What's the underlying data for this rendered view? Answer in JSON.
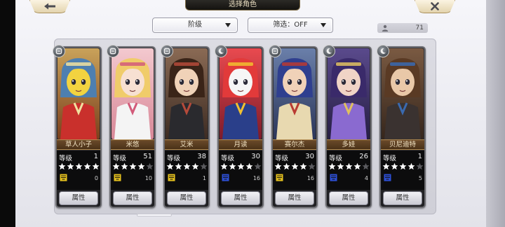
{
  "header": {
    "title": "选择角色",
    "back_icon": "back-arrow-icon",
    "close_icon": "close-x-icon"
  },
  "toolbar": {
    "sort_label": "阶级",
    "filter_label": "筛选：OFF",
    "character_count": "71",
    "count_icon": "user-icon"
  },
  "characters": [
    {
      "name": "草人小子",
      "level_label": "等级",
      "level": "1",
      "stars": 5,
      "count": "0",
      "rank_color": "#e6c21e",
      "type_icon": "plain-type-icon"
    },
    {
      "name": "米悠",
      "level_label": "等级",
      "level": "51",
      "stars": 4,
      "count": "10",
      "rank_color": "#e6c21e",
      "type_icon": "plain-type-icon"
    },
    {
      "name": "艾米",
      "level_label": "等级",
      "level": "38",
      "stars": 4,
      "count": "1",
      "rank_color": "#e6c21e",
      "type_icon": "plain-type-icon"
    },
    {
      "name": "月读",
      "level_label": "等级",
      "level": "30",
      "stars": 4,
      "count": "16",
      "rank_color": "#2d4fd6",
      "type_icon": "moon-type-icon"
    },
    {
      "name": "赛尔杰",
      "level_label": "等级",
      "level": "30",
      "stars": 4,
      "count": "16",
      "rank_color": "#e6c21e",
      "type_icon": "plain-type-icon"
    },
    {
      "name": "多娃",
      "level_label": "等级",
      "level": "26",
      "stars": 4,
      "count": "4",
      "rank_color": "#2d4fd6",
      "type_icon": "moon-type-icon"
    },
    {
      "name": "贝尼迪特",
      "level_label": "等级",
      "level": "1",
      "stars": 4,
      "count": "5",
      "rank_color": "#2d4fd6",
      "type_icon": "moon-type-icon"
    }
  ],
  "attribute_label": "属性",
  "colors": {
    "star_on": "#ffffff",
    "star_off": "#5a5a5e",
    "accent": "#b08a50"
  }
}
